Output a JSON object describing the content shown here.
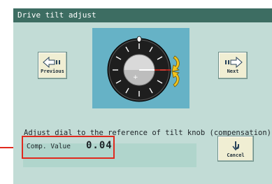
{
  "window": {
    "title": "Drive tilt adjust"
  },
  "nav": {
    "previous_label": "Previous",
    "next_label": "Next"
  },
  "instruction": "Adjust dial to the reference of tilt knob (compensation).",
  "compensation": {
    "label": "Comp. Value",
    "value": "0.04"
  },
  "cancel": {
    "label": "Cancel"
  },
  "colors": {
    "panel": "#c2dcd6",
    "titlebar": "#3d6d62",
    "dial_box": "#66b2c6",
    "button_face": "#f0eed3",
    "highlight_red": "#e02a1e",
    "arrow_yellow": "#f2c31b"
  },
  "icons": {
    "previous": "arrow-left-icon",
    "next": "arrow-right-icon",
    "dial": "tilt-dial-icon",
    "rotate": "rotate-arrows-icon",
    "cancel": "return-arrow-icon"
  }
}
